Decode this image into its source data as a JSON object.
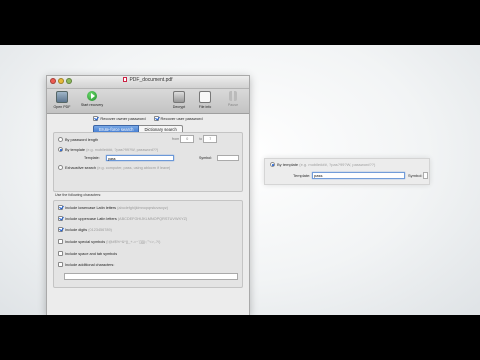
{
  "window": {
    "title": "PDF_document.pdf"
  },
  "toolbar": {
    "open_label": "Open PDF",
    "start_label": "Start recovery",
    "decrypt_label": "Decrypt",
    "info_label": "File info",
    "pause_label": "Pause"
  },
  "options": {
    "owner_label": "Recover owner password",
    "user_label": "Recover user password"
  },
  "tabs": {
    "brute_force": "Brute-force search",
    "dictionary": "Dictionary search"
  },
  "search": {
    "by_length_label": "By password length",
    "from_label": "from",
    "from_value": "0",
    "to_label": "to",
    "to_value": "7",
    "by_template_label": "By template",
    "template_hint": "(e.g. mobile###, ?pas?99?W, password??)",
    "template_label": "Template:",
    "template_value": "pass",
    "symbol_label": "Symbol:",
    "exhaustive_label": "Exhaustive search",
    "exhaustive_hint": "(e.g. computer, pass, using ablocm if leave)"
  },
  "charset": {
    "title": "Use the following characters:",
    "lowercase_label": "Include lowercase Latin letters",
    "lowercase_hint": "(abcdefghijklmnopqrstuvwxyz)",
    "uppercase_label": "Include uppercase Latin letters",
    "uppercase_hint": "(ABCDEFGHIJKLMNOPQRSTUVWXYZ)",
    "digits_label": "Include digits",
    "digits_hint": "(0123456789)",
    "special_label": "Include special symbols",
    "special_hint": "(!@#$%^&*()_+-=~`[]{}|:;\"'<>,.?/)",
    "space_label": "Include space and tab symbols",
    "additional_label": "Include additional characters:"
  },
  "zoom": {
    "by_template_label": "By template",
    "template_hint": "(e.g. mobile###, ?pas?99?W, password??)",
    "template_label": "Template:",
    "template_value": "pass",
    "symbol_label": "Symbol:"
  },
  "colors": {
    "accent": "#3f79d0",
    "start_green": "#1f8f2a"
  }
}
